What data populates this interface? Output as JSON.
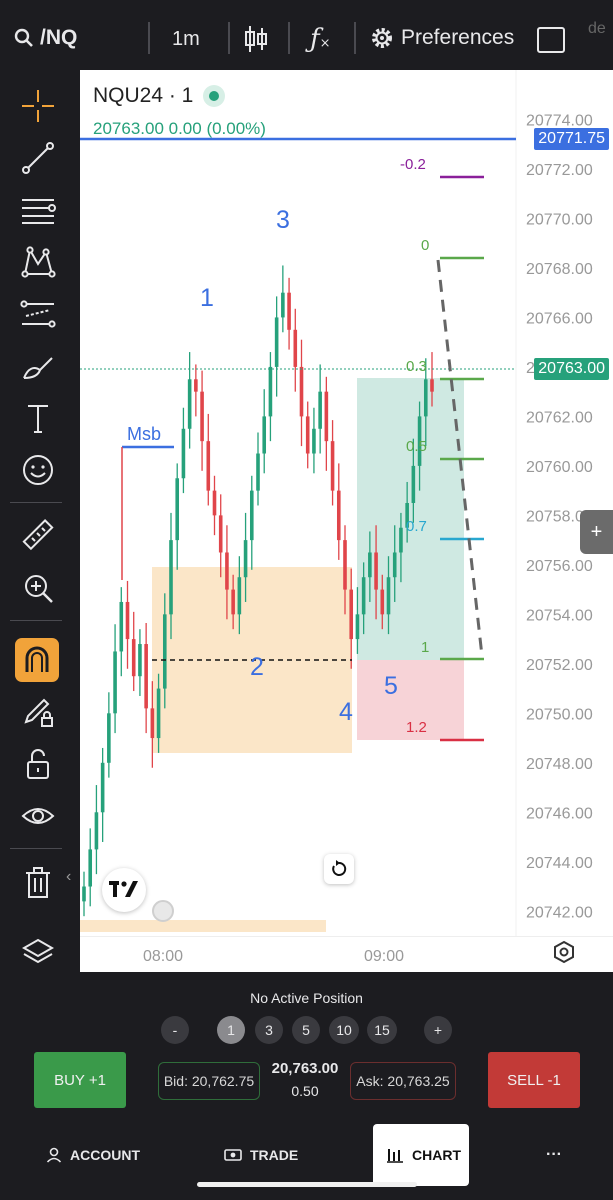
{
  "topbar": {
    "symbol": "/NQ",
    "timeframe": "1m",
    "preferences": "Preferences",
    "overflow_text": "de"
  },
  "sidebar": {
    "tools": [
      {
        "name": "crosshair-icon"
      },
      {
        "name": "trendline-icon"
      },
      {
        "name": "fib-retracement-icon"
      },
      {
        "name": "patterns-icon"
      },
      {
        "name": "forecast-icon"
      },
      {
        "name": "brush-icon"
      },
      {
        "name": "text-icon"
      },
      {
        "name": "emoji-icon"
      },
      {
        "name": "ruler-icon"
      },
      {
        "name": "zoom-icon"
      },
      {
        "name": "magnet-icon"
      },
      {
        "name": "lock-drawing-icon"
      },
      {
        "name": "unlock-icon"
      },
      {
        "name": "eye-icon"
      },
      {
        "name": "trash-icon"
      },
      {
        "name": "layers-icon"
      }
    ]
  },
  "chart": {
    "title": "NQU24 · 1",
    "quote": "20763.00  0.00 (0.00%)",
    "price_tag_blue": "20771.75",
    "price_tag_green": "20763.00",
    "time_labels": [
      "08:00",
      "09:00"
    ],
    "labels": {
      "msb": "Msb",
      "w1": "1",
      "w2": "2",
      "w3": "3",
      "w4": "4",
      "w5": "5"
    },
    "fib_levels": {
      "m02": "-0.2",
      "l0": "0",
      "l03": "0.3",
      "l05": "0.5",
      "l07": "0.7",
      "l1": "1",
      "l12": "1.2"
    },
    "colors": {
      "up": "#26a17b",
      "down": "#e0454a",
      "accent_blue": "#3b6fe0",
      "fib_green": "#5aa84a",
      "fib_purple": "#8a1f9a",
      "fib_red": "#d93044",
      "fib_cyan": "#28a7cf",
      "zone_orange": "#fbe6c8",
      "zone_green": "#cfe9e2",
      "zone_red": "#f7d3d7"
    }
  },
  "chart_data": {
    "type": "candlestick",
    "symbol": "NQU24",
    "interval": "1",
    "y_ticks": [
      "20774.00",
      "20772.00",
      "20770.00",
      "20768.00",
      "20766.00",
      "20764.00",
      "20762.00",
      "20760.00",
      "20758.00",
      "20756.00",
      "20754.00",
      "20752.00",
      "20750.00",
      "20748.00",
      "20746.00",
      "20744.00",
      "20742.00"
    ],
    "ylim": [
      20741,
      20776
    ],
    "x_ticks": [
      "08:00",
      "09:00"
    ],
    "last_price": 20763.0,
    "blue_line_price": 20771.75,
    "close_series": [
      20743,
      20744.5,
      20746,
      20748,
      20750,
      20752.5,
      20754.5,
      20753,
      20751.5,
      20752.8,
      20750.2,
      20749,
      20751,
      20754,
      20757,
      20759.5,
      20761.5,
      20763.5,
      20763,
      20761,
      20759,
      20758,
      20756.5,
      20755,
      20754,
      20755.5,
      20757,
      20759,
      20760.5,
      20762,
      20764,
      20766,
      20767,
      20765.5,
      20764,
      20762,
      20760.5,
      20761.5,
      20763,
      20761,
      20759,
      20757,
      20755,
      20753,
      20754,
      20755.5,
      20756.5,
      20755,
      20754,
      20755.5,
      20756.5,
      20757.5,
      20758.5,
      20760,
      20762,
      20763.5,
      20763
    ]
  },
  "trade": {
    "status": "No Active Position",
    "quantities": [
      "-",
      "1",
      "3",
      "5",
      "10",
      "15",
      "+"
    ],
    "selected_qty": "1",
    "buy_label": "BUY +1",
    "sell_label": "SELL -1",
    "bid": "Bid: 20,762.75",
    "ask": "Ask: 20,763.25",
    "mid_price": "20,763.00",
    "spread": "0.50"
  },
  "nav": {
    "account": "ACCOUNT",
    "trade": "TRADE",
    "chart": "CHART",
    "more": "···"
  }
}
